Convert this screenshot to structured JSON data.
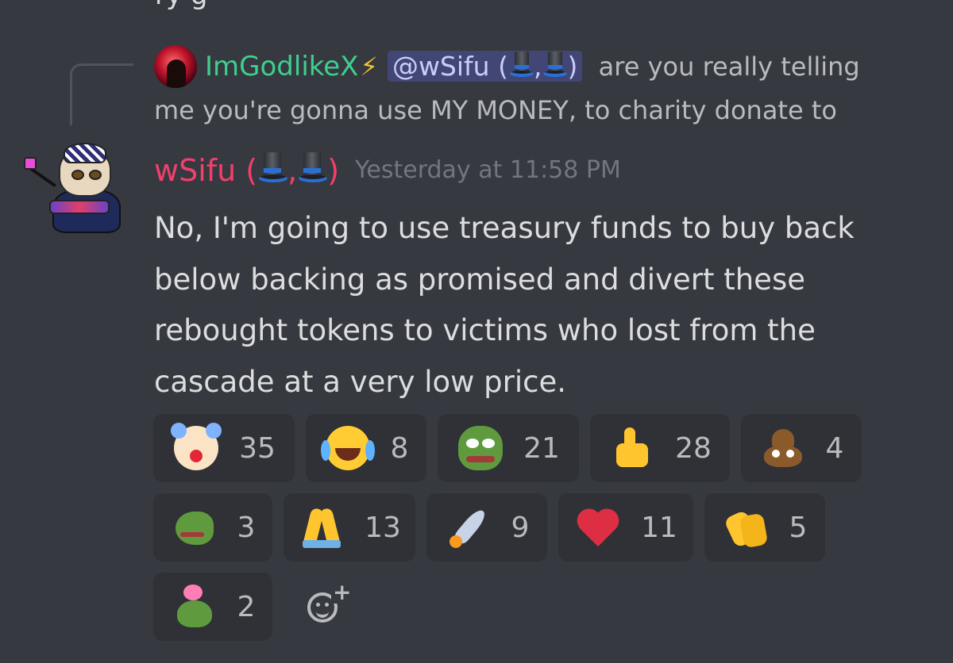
{
  "top_partial_text": "ry                                    g",
  "reply": {
    "author": "ImGodlikeX",
    "mention": "@wSifu (",
    "mention_sep": ",",
    "mention_close": ")",
    "text_line1": "are you really telling",
    "text_line2": "me you're gonna use MY MONEY, to charity donate to"
  },
  "message": {
    "author": "wSifu (",
    "author_sep": ",",
    "author_close": ")",
    "timestamp": "Yesterday at 11:58 PM",
    "text": "No, I'm going to use treasury funds to buy back below backing as promised and divert these rebought tokens to victims who lost from the cascade at a very low price."
  },
  "reactions": [
    [
      {
        "icon": "clown-face-icon",
        "count": "35"
      },
      {
        "icon": "face-with-tears-of-joy-icon",
        "count": "8"
      },
      {
        "icon": "pepe-frog-icon",
        "count": "21"
      },
      {
        "icon": "thumbs-up-icon",
        "count": "28"
      },
      {
        "icon": "pile-of-poo-icon",
        "count": "4"
      }
    ],
    [
      {
        "icon": "pepe-side-icon",
        "count": "3"
      },
      {
        "icon": "folded-hands-icon",
        "count": "13"
      },
      {
        "icon": "rocket-icon",
        "count": "9"
      },
      {
        "icon": "red-heart-icon",
        "count": "11"
      },
      {
        "icon": "clapping-hands-icon",
        "count": "5"
      }
    ],
    [
      {
        "icon": "pepe-love-icon",
        "count": "2"
      }
    ]
  ],
  "colors": {
    "background": "#36393f",
    "reaction_bg": "#2f3136",
    "reply_author": "#3ecf8e",
    "message_author": "#f23f6b",
    "mention_bg": "#414675"
  }
}
